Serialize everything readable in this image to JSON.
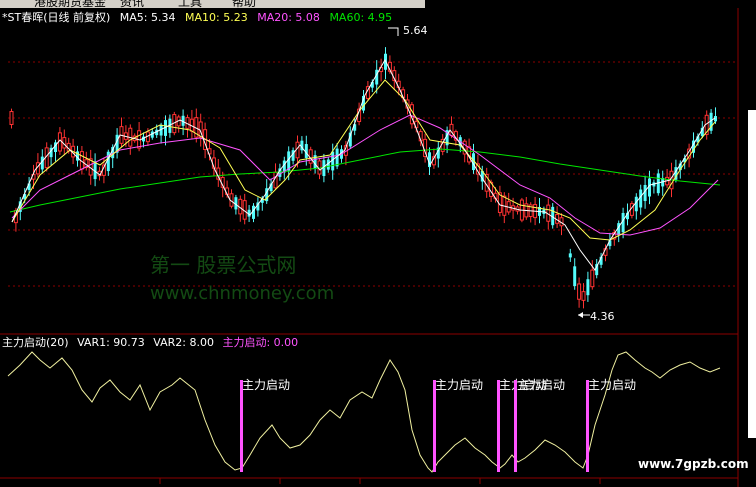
{
  "menu": {
    "items": [
      "港股期货基金",
      "资讯",
      "工具",
      "帮助"
    ]
  },
  "header": {
    "stock_name": "*ST春晖(日线 前复权)",
    "ma5_label": "MA5: 5.34",
    "ma10_label": "MA10: 5.23",
    "ma20_label": "MA20: 5.08",
    "ma60_label": "MA60: 4.95"
  },
  "annotations": {
    "high": "5.64",
    "low": "4.36"
  },
  "indicator": {
    "name": "主力启动(20)",
    "var1": "VAR1: 90.73",
    "var2": "VAR2: 8.00",
    "signal": "主力启动: 0.00",
    "signal_label": "主力启动",
    "signal_label_b": "主力启动",
    "overlap_label": "主力启动"
  },
  "watermark": {
    "line1": "第一 股票公式网",
    "line2": "www.chnmoney.com",
    "corner": "www.7gpzb.com"
  },
  "colors": {
    "up": "#54fcfc",
    "down": "#ff3232",
    "ma5": "#ffffff",
    "ma10": "#ffff54",
    "ma20": "#ff54ff",
    "ma60": "#00e600",
    "signal": "#ff54ff",
    "grid": "#8b0000"
  }
}
